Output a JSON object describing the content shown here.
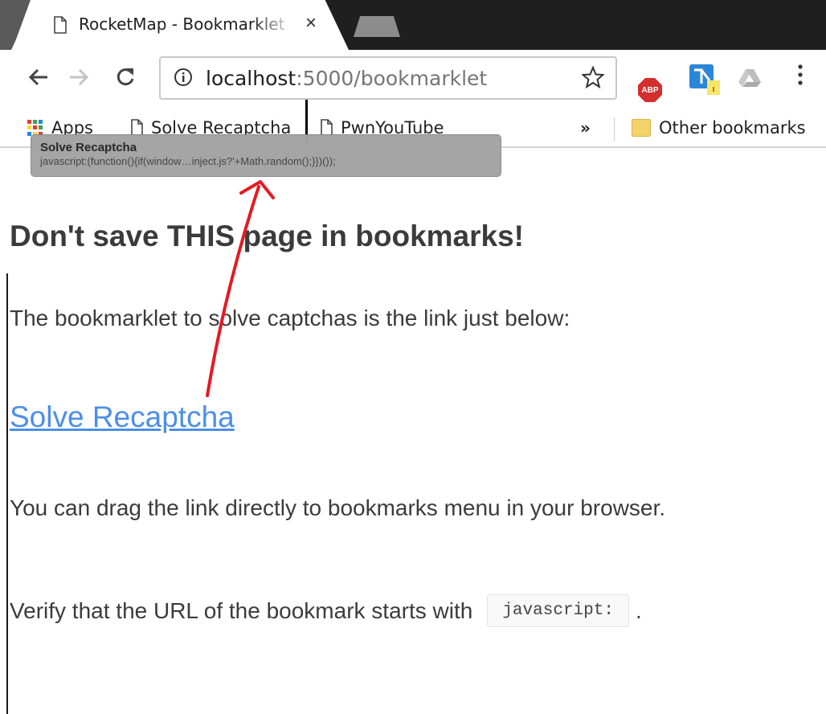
{
  "browser": {
    "tab": {
      "title": "RocketMap - Bookmarklet",
      "close_icon": "×"
    },
    "address_bar": {
      "host": "localhost",
      "path": ":5000/bookmarklet"
    },
    "extensions": {
      "abp_label": "ABP"
    },
    "bookmarks_bar": {
      "apps_label": "Apps",
      "items": [
        "Solve Recaptcha",
        "PwnYouTube"
      ],
      "overflow_label": "»",
      "other_bookmarks_label": "Other bookmarks"
    },
    "tooltip": {
      "title": "Solve Recaptcha",
      "url": "javascript:(function(){if(window…inject.js?'+Math.random();}})());"
    }
  },
  "page": {
    "heading": "Don't save THIS page in bookmarks!",
    "intro": "The bookmarklet to solve captchas is the link just below:",
    "link_label": "Solve Recaptcha",
    "drag_hint": "You can drag the link directly to bookmarks menu in your browser.",
    "verify_text": "Verify that the URL of the bookmark starts with",
    "verify_code": "javascript:",
    "verify_end": "."
  },
  "colors": {
    "link": "#4c8fe8",
    "annotation_arrow": "#e31b23",
    "tooltip_bg": "#a3a3a3"
  }
}
